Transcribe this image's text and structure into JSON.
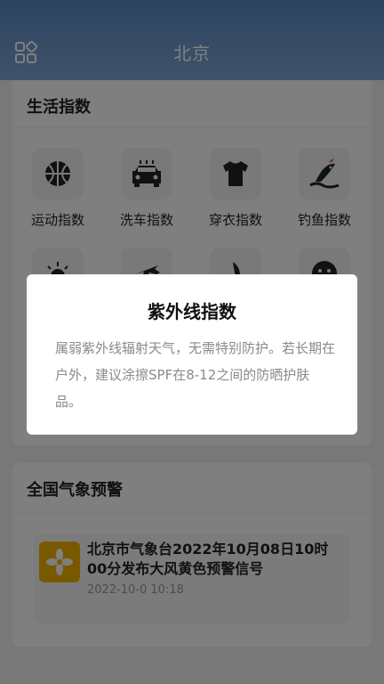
{
  "header": {
    "title": "北京",
    "menu_icon": "grid-menu-icon"
  },
  "life_index": {
    "title": "生活指数",
    "items": [
      {
        "label": "运动指数",
        "icon": "basketball-icon"
      },
      {
        "label": "洗车指数",
        "icon": "car-icon"
      },
      {
        "label": "穿衣指数",
        "icon": "tshirt-icon"
      },
      {
        "label": "钓鱼指数",
        "icon": "fishing-icon"
      },
      {
        "label": "",
        "icon": "sun-icon"
      },
      {
        "label": "",
        "icon": "airplane-icon"
      },
      {
        "label": "",
        "icon": "umbrella-icon"
      },
      {
        "label": "",
        "icon": "face-icon"
      }
    ]
  },
  "national_alert": {
    "title": "全国气象预警",
    "items": [
      {
        "title": "北京市气象台2022年10月08日10时00分发布大风黄色预警信号",
        "time": "2022-10-0 10:18",
        "icon": "wind-warning-icon",
        "color": "#f2b200"
      }
    ]
  },
  "modal": {
    "title": "紫外线指数",
    "body": "属弱紫外线辐射天气，无需特别防护。若长期在户外，建议涂擦SPF在8-12之间的防晒护肤品。"
  }
}
